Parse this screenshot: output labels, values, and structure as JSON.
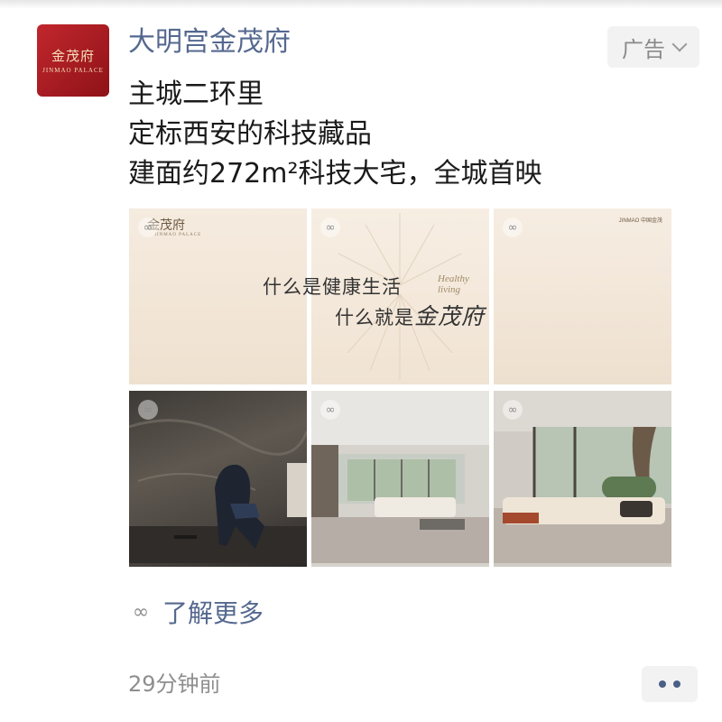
{
  "ad_card": {
    "account": {
      "name": "大明宫金茂府",
      "logo_text": "金茂府",
      "logo_subtext": "JINMAO PALACE"
    },
    "ad_menu": {
      "label": "广告",
      "icon": "chevron-down-icon"
    },
    "body_lines": [
      "主城二环里",
      "定标西安的科技藏品",
      "建面约272m²科技大宅，全城首映"
    ],
    "images": [
      {
        "kind": "banner",
        "logo_text": "金茂府",
        "logo_subtext": "JINMAO PALACE"
      },
      {
        "kind": "banner",
        "slogan_line1": "什么是健康生活",
        "slogan_line2": "什么就是",
        "slogan_brand": "金茂府",
        "english_text": [
          "Healthy",
          "living"
        ]
      },
      {
        "kind": "banner",
        "brands_text": "JINMAO 中国金茂"
      },
      {
        "kind": "photo",
        "scene": "marble-wall-lounge-chair"
      },
      {
        "kind": "photo",
        "scene": "living-room-with-garden-window"
      },
      {
        "kind": "photo",
        "scene": "sofa-by-courtyard-window"
      }
    ],
    "learn_more": {
      "label": "了解更多",
      "icon": "link-icon"
    },
    "timestamp": "29分钟前",
    "more_menu": {
      "icon": "more-dots-icon"
    }
  },
  "colors": {
    "link_blue": "#55688f",
    "brand_red": "#b0202a",
    "body_text": "#1a1a1a",
    "muted_gray": "#8e8e8e",
    "button_bg": "#f2f2f2"
  }
}
